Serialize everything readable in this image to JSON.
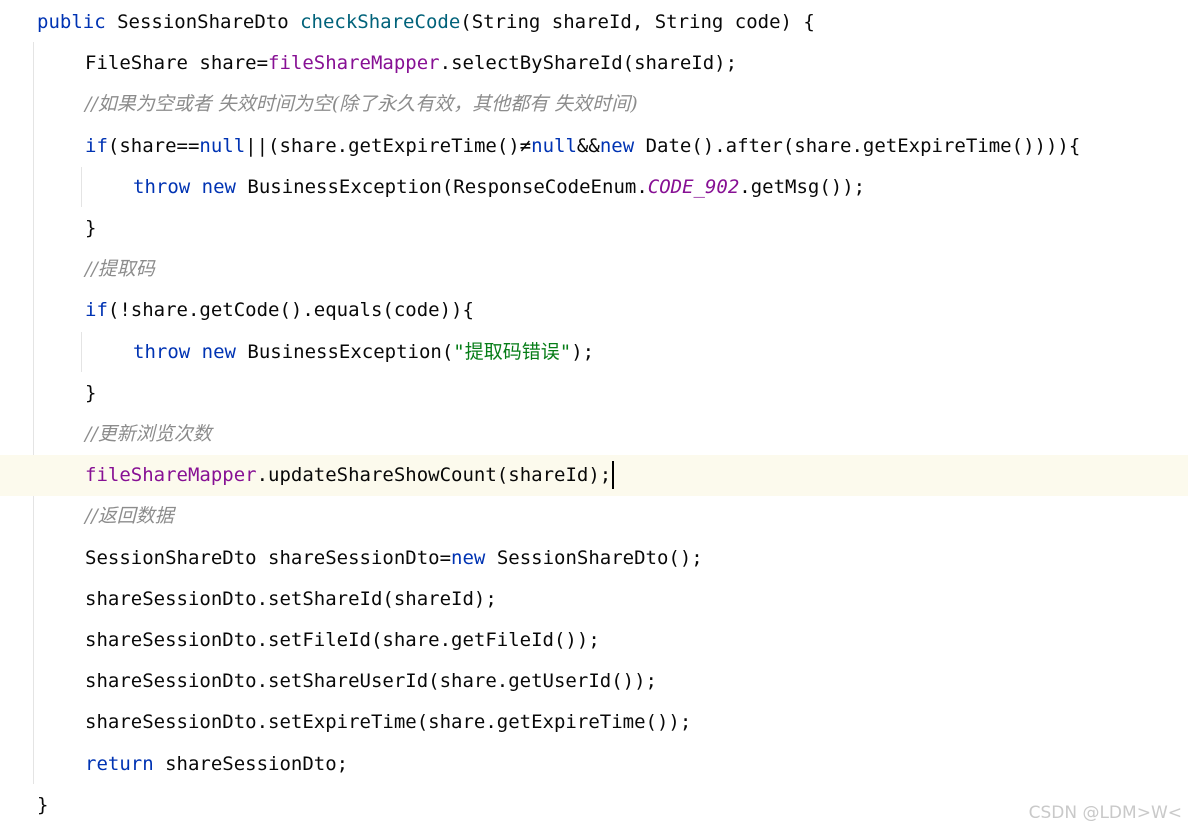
{
  "editor": {
    "colors": {
      "keyword": "#0033b3",
      "method_declaration": "#00627a",
      "field": "#871094",
      "string": "#067d17",
      "comment": "#8c8c8c",
      "plain": "#080808",
      "current_line_background": "#fcfaed"
    },
    "lines": [
      {
        "indent": 0,
        "tokens": [
          {
            "t": "public ",
            "c": "kw"
          },
          {
            "t": "SessionShareDto ",
            "c": "plain"
          },
          {
            "t": "checkShareCode",
            "c": "method-decl"
          },
          {
            "t": "(String shareId, String code) {",
            "c": "plain"
          }
        ]
      },
      {
        "indent": 1,
        "tokens": [
          {
            "t": "FileShare share=",
            "c": "plain"
          },
          {
            "t": "fileShareMapper",
            "c": "field"
          },
          {
            "t": ".selectByShareId(shareId);",
            "c": "plain"
          }
        ]
      },
      {
        "indent": 1,
        "tokens": [
          {
            "t": "//如果为空或者 失效时间为空(除了永久有效，其他都有 失效时间)",
            "c": "comment"
          }
        ]
      },
      {
        "indent": 1,
        "tokens": [
          {
            "t": "if",
            "c": "kw"
          },
          {
            "t": "(share==",
            "c": "plain"
          },
          {
            "t": "null",
            "c": "kw"
          },
          {
            "t": "||(share.getExpireTime()≠",
            "c": "plain"
          },
          {
            "t": "null",
            "c": "kw"
          },
          {
            "t": "&&",
            "c": "plain"
          },
          {
            "t": "new ",
            "c": "kw"
          },
          {
            "t": "Date().after(share.getExpireTime()))){",
            "c": "plain"
          }
        ]
      },
      {
        "indent": 2,
        "tokens": [
          {
            "t": "throw new ",
            "c": "kw"
          },
          {
            "t": "BusinessException(ResponseCodeEnum.",
            "c": "plain"
          },
          {
            "t": "CODE_902",
            "c": "static-field"
          },
          {
            "t": ".getMsg());",
            "c": "plain"
          }
        ]
      },
      {
        "indent": 1,
        "tokens": [
          {
            "t": "}",
            "c": "plain"
          }
        ]
      },
      {
        "indent": 1,
        "tokens": [
          {
            "t": "//提取码",
            "c": "comment"
          }
        ]
      },
      {
        "indent": 1,
        "tokens": [
          {
            "t": "if",
            "c": "kw"
          },
          {
            "t": "(!share.getCode().equals(code)){",
            "c": "plain"
          }
        ]
      },
      {
        "indent": 2,
        "tokens": [
          {
            "t": "throw new ",
            "c": "kw"
          },
          {
            "t": "BusinessException(",
            "c": "plain"
          },
          {
            "t": "\"提取码错误\"",
            "c": "str"
          },
          {
            "t": ");",
            "c": "plain"
          }
        ]
      },
      {
        "indent": 1,
        "tokens": [
          {
            "t": "}",
            "c": "plain"
          }
        ]
      },
      {
        "indent": 1,
        "tokens": [
          {
            "t": "//更新浏览次数",
            "c": "comment"
          }
        ]
      },
      {
        "indent": 1,
        "current": true,
        "tokens": [
          {
            "t": "fileShareMapper",
            "c": "field"
          },
          {
            "t": ".updateShareShowCount(shareId);",
            "c": "plain"
          }
        ]
      },
      {
        "indent": 1,
        "tokens": [
          {
            "t": "//返回数据",
            "c": "comment"
          }
        ]
      },
      {
        "indent": 1,
        "tokens": [
          {
            "t": "SessionShareDto shareSessionDto=",
            "c": "plain"
          },
          {
            "t": "new ",
            "c": "kw"
          },
          {
            "t": "SessionShareDto();",
            "c": "plain"
          }
        ]
      },
      {
        "indent": 1,
        "tokens": [
          {
            "t": "shareSessionDto.setShareId(shareId);",
            "c": "plain"
          }
        ]
      },
      {
        "indent": 1,
        "tokens": [
          {
            "t": "shareSessionDto.setFileId(share.getFileId());",
            "c": "plain"
          }
        ]
      },
      {
        "indent": 1,
        "tokens": [
          {
            "t": "shareSessionDto.setShareUserId(share.getUserId());",
            "c": "plain"
          }
        ]
      },
      {
        "indent": 1,
        "tokens": [
          {
            "t": "shareSessionDto.setExpireTime(share.getExpireTime());",
            "c": "plain"
          }
        ]
      },
      {
        "indent": 1,
        "tokens": [
          {
            "t": "return ",
            "c": "kw"
          },
          {
            "t": "shareSessionDto;",
            "c": "plain"
          }
        ]
      },
      {
        "indent": 0,
        "tokens": [
          {
            "t": "}",
            "c": "plain"
          }
        ]
      }
    ]
  },
  "watermark": {
    "text": "CSDN @LDM>W<"
  }
}
